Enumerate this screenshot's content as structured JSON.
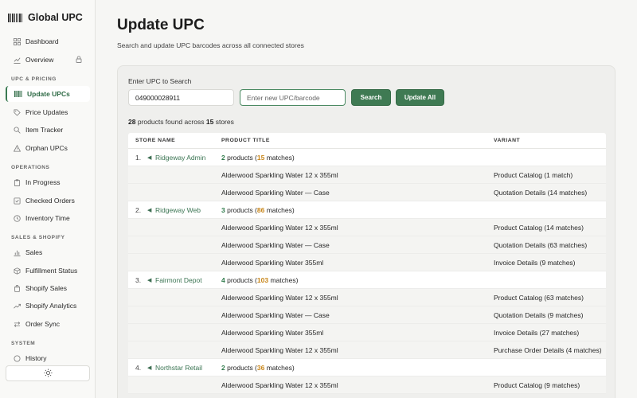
{
  "brand": {
    "title": "Global UPC",
    "logo_icon": "barcode-icon"
  },
  "sidebar": {
    "top_items": [
      {
        "label": "Dashboard",
        "icon": "grid-icon"
      },
      {
        "label": "Overview",
        "icon": "chart-line-icon",
        "locked": true
      }
    ],
    "sections": [
      {
        "title": "UPC & PRICING",
        "items": [
          {
            "label": "Update UPCs",
            "icon": "barcode-icon",
            "active": true
          },
          {
            "label": "Price Updates",
            "icon": "tag-icon"
          },
          {
            "label": "Item Tracker",
            "icon": "search-icon"
          },
          {
            "label": "Orphan UPCs",
            "icon": "warning-icon"
          }
        ]
      },
      {
        "title": "OPERATIONS",
        "items": [
          {
            "label": "In Progress",
            "icon": "clipboard-icon"
          },
          {
            "label": "Checked Orders",
            "icon": "checklist-icon"
          },
          {
            "label": "Inventory Time",
            "icon": "clock-icon"
          }
        ]
      },
      {
        "title": "SALES & SHOPIFY",
        "items": [
          {
            "label": "Sales",
            "icon": "bar-chart-icon"
          },
          {
            "label": "Fulfillment Status",
            "icon": "box-icon"
          },
          {
            "label": "Shopify Sales",
            "icon": "bag-icon"
          },
          {
            "label": "Shopify Analytics",
            "icon": "trend-icon"
          },
          {
            "label": "Order Sync",
            "icon": "sync-icon"
          }
        ]
      },
      {
        "title": "SYSTEM",
        "items": [
          {
            "label": "History",
            "icon": "history-icon"
          }
        ]
      }
    ],
    "theme_toggle_icon": "sun-icon"
  },
  "page": {
    "title": "Update UPC",
    "subtitle": "Search and update UPC barcodes across all connected stores"
  },
  "form": {
    "label": "Enter UPC to Search",
    "upc_value": "049000028911",
    "new_upc_placeholder": "Enter new UPC/barcode",
    "search_label": "Search",
    "update_all_label": "Update All"
  },
  "summary": {
    "products": "28",
    "middle": "products found across",
    "stores": "15",
    "end": "stores"
  },
  "table": {
    "headers": [
      "STORE NAME",
      "PRODUCT TITLE",
      "VARIANT"
    ],
    "groups": [
      {
        "index": "1.",
        "store": "Ridgeway Admin",
        "products": "2",
        "matches": "15",
        "rows": [
          {
            "title": "Alderwood Sparkling Water 12 x 355ml",
            "variant": "Product Catalog (1 match)"
          },
          {
            "title": "Alderwood Sparkling Water — Case",
            "variant": "Quotation Details (14 matches)"
          }
        ]
      },
      {
        "index": "2.",
        "store": "Ridgeway Web",
        "products": "3",
        "matches": "86",
        "rows": [
          {
            "title": "Alderwood Sparkling Water 12 x 355ml",
            "variant": "Product Catalog (14 matches)"
          },
          {
            "title": "Alderwood Sparkling Water — Case",
            "variant": "Quotation Details (63 matches)"
          },
          {
            "title": "Alderwood Sparkling Water 355ml",
            "variant": "Invoice Details (9 matches)"
          }
        ]
      },
      {
        "index": "3.",
        "store": "Fairmont Depot",
        "products": "4",
        "matches": "103",
        "rows": [
          {
            "title": "Alderwood Sparkling Water 12 x 355ml",
            "variant": "Product Catalog (63 matches)"
          },
          {
            "title": "Alderwood Sparkling Water — Case",
            "variant": "Quotation Details (9 matches)"
          },
          {
            "title": "Alderwood Sparkling Water 355ml",
            "variant": "Invoice Details (27 matches)"
          },
          {
            "title": "Alderwood Sparkling Water 12 x 355ml",
            "variant": "Purchase Order Details (4 matches)"
          }
        ]
      },
      {
        "index": "4.",
        "store": "Northstar Retail",
        "products": "2",
        "matches": "36",
        "rows": [
          {
            "title": "Alderwood Sparkling Water 12 x 355ml",
            "variant": "Product Catalog (9 matches)"
          }
        ]
      }
    ]
  },
  "colors": {
    "accent": "#3f7a53",
    "match_count": "#c8861a"
  }
}
